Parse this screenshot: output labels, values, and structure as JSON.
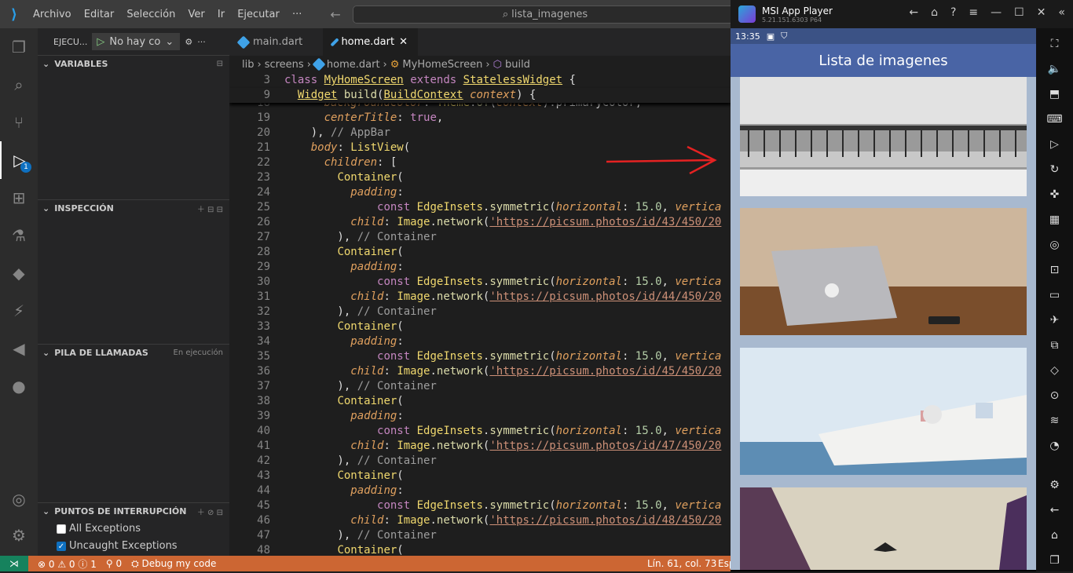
{
  "menu": {
    "items": [
      "Archivo",
      "Editar",
      "Selección",
      "Ver",
      "Ir",
      "Ejecutar",
      "···"
    ],
    "search": "lista_imagenes"
  },
  "sidebar": {
    "run_label": "EJECU...",
    "run_config": "No hay co",
    "variables": "VARIABLES",
    "inspect": "INSPECCIÓN",
    "callstack": "PILA DE LLAMADAS",
    "callstack_status": "En ejecución",
    "breakpoints": "PUNTOS DE INTERRUPCIÓN",
    "all_exceptions": "All Exceptions",
    "uncaught_exceptions": "Uncaught Exceptions"
  },
  "tabs": [
    {
      "label": "main.dart"
    },
    {
      "label": "home.dart"
    }
  ],
  "breadcrumb": {
    "a": "lib",
    "b": "screens",
    "c": "home.dart",
    "d": "MyHomeScreen",
    "e": "build"
  },
  "status": {
    "errors": "0",
    "warnings": "0",
    "info": "1",
    "ports": "0",
    "debug": "Debug my code",
    "position": "Lín. 61, col. 73",
    "lang": "Esp"
  },
  "emulator": {
    "title": "MSI App Player",
    "version": "5.21.151.6303 P64",
    "time": "13:35",
    "app_title": "Lista de imagenes"
  },
  "activity": {
    "debug_badge": "1"
  },
  "code_urls": [
    "'https://picsum.photos/id/43/450/20",
    "'https://picsum.photos/id/44/450/20",
    "'https://picsum.photos/id/45/450/20",
    "'https://picsum.photos/id/47/450/20",
    "'https://picsum.photos/id/48/450/20"
  ]
}
